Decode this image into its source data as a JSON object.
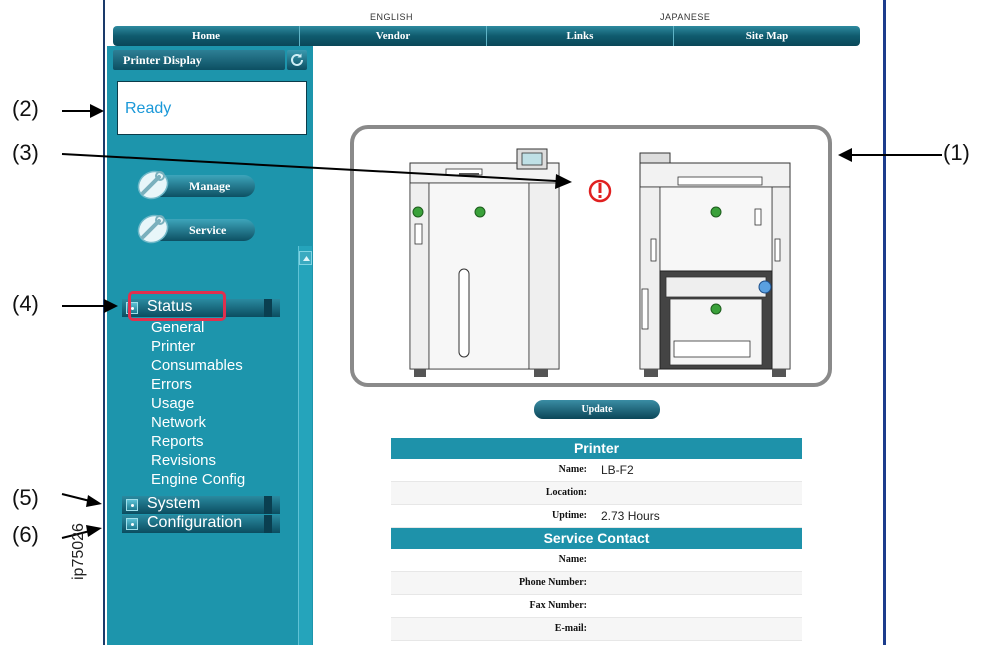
{
  "callouts": {
    "c1": "(1)",
    "c2": "(2)",
    "c3": "(3)",
    "c4": "(4)",
    "c5": "(5)",
    "c6": "(6)"
  },
  "doc_id": "ip75026",
  "languages": [
    "ENGLISH",
    "JAPANESE"
  ],
  "top_nav": [
    "Home",
    "Vendor",
    "Links",
    "Site Map"
  ],
  "sidebar": {
    "printer_display_label": "Printer Display",
    "status_text": "Ready",
    "manage_label": "Manage",
    "service_label": "Service",
    "status_section": "Status",
    "status_items": [
      "General",
      "Printer",
      "Consumables",
      "Errors",
      "Usage",
      "Network",
      "Reports",
      "Revisions",
      "Engine Config"
    ],
    "system_section": "System",
    "configuration_section": "Configuration"
  },
  "main": {
    "update_label": "Update",
    "printer_header": "Printer",
    "printer_rows": [
      {
        "key": "Name:",
        "value": "LB-F2"
      },
      {
        "key": "Location:",
        "value": ""
      },
      {
        "key": "Uptime:",
        "value": "2.73 Hours"
      }
    ],
    "contact_header": "Service Contact",
    "contact_rows": [
      {
        "key": "Name:",
        "value": ""
      },
      {
        "key": "Phone Number:",
        "value": ""
      },
      {
        "key": "Fax Number:",
        "value": ""
      },
      {
        "key": "E-mail:",
        "value": ""
      }
    ]
  },
  "colors": {
    "teal_panel": "#1d95ac",
    "nav_dark": "#0f5b6e",
    "ready_text": "#1a98d8",
    "highlight_red": "#e0304e",
    "error_red": "#e02020"
  },
  "icons": {
    "refresh": "refresh-icon",
    "manage": "wrench-disc-icon",
    "service": "wrench-disc-icon",
    "error": "exclamation-circle-icon"
  }
}
